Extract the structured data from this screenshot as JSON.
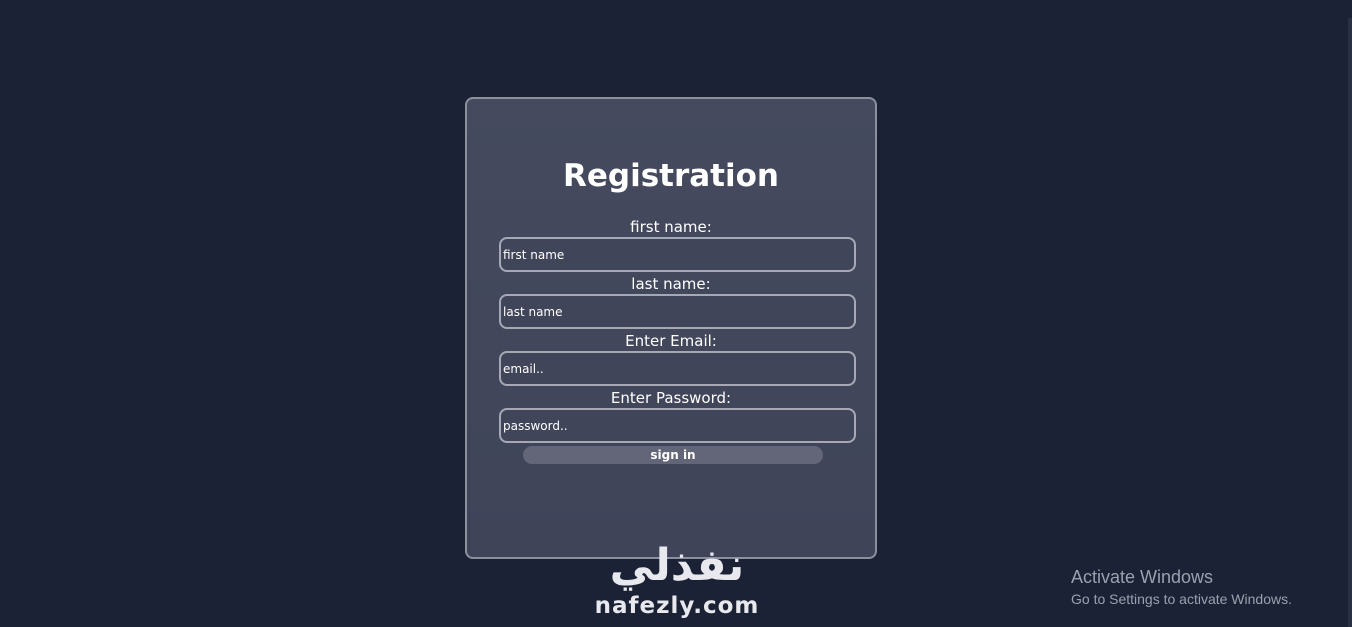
{
  "form": {
    "title": "Registration",
    "fields": [
      {
        "label": "first name:",
        "placeholder": "first name"
      },
      {
        "label": "last name:",
        "placeholder": "last name"
      },
      {
        "label": "Enter Email:",
        "placeholder": "email.."
      },
      {
        "label": "Enter Password:",
        "placeholder": "password.."
      }
    ],
    "submit_label": "sign in"
  },
  "watermark": {
    "arabic": "نفذلي",
    "domain": "nafezly.com"
  },
  "os_notice": {
    "title": "Activate Windows",
    "subtitle": "Go to Settings to activate Windows."
  },
  "colors": {
    "background": "#1b2236",
    "card": "#42475c",
    "card_border": "#8c909e",
    "button": "#626678"
  }
}
